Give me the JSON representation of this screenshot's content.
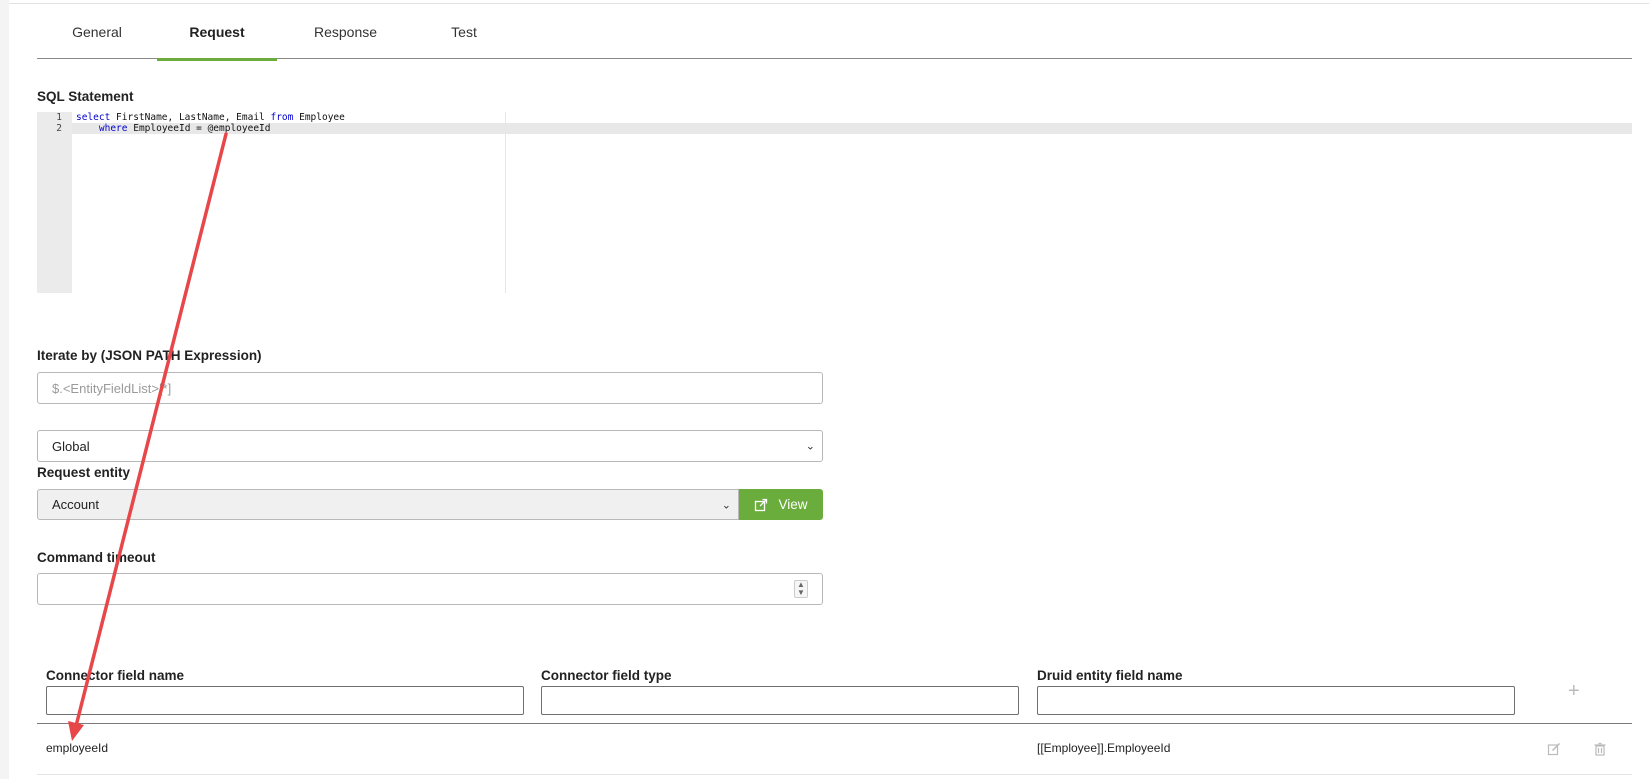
{
  "tabs": [
    {
      "label": "General"
    },
    {
      "label": "Request"
    },
    {
      "label": "Response"
    },
    {
      "label": "Test"
    }
  ],
  "active_tab": "Request",
  "sql": {
    "label": "SQL Statement",
    "line_numbers": [
      "1",
      "2"
    ],
    "line1": {
      "k1": "select",
      "t1": " FirstName, LastName, Email ",
      "k2": "from",
      "t2": " Employee"
    },
    "line2": {
      "indent": "    ",
      "k1": "where",
      "t1": " EmployeeId = @employeeId"
    }
  },
  "iterate": {
    "label": "Iterate by (JSON PATH Expression)",
    "placeholder": "$.<EntityFieldList>[*]",
    "value": ""
  },
  "scope_select": {
    "value": "Global"
  },
  "request_entity": {
    "label": "Request entity",
    "value": "Account",
    "view_label": "View"
  },
  "command_timeout": {
    "label": "Command timeout",
    "value": ""
  },
  "mapping_table": {
    "columns": [
      "Connector field name",
      "Connector field type",
      "Druid entity field name"
    ],
    "rows": [
      {
        "connector_field_name": "employeeId",
        "connector_field_type": "",
        "druid_entity_field_name": "[[Employee]].EmployeeId"
      }
    ]
  },
  "colors": {
    "accent": "#6aad3d",
    "annotation_arrow": "#e8474a"
  },
  "icons": {
    "view": "external-link-icon",
    "add": "plus-icon",
    "edit": "edit-icon",
    "delete": "trash-icon"
  }
}
